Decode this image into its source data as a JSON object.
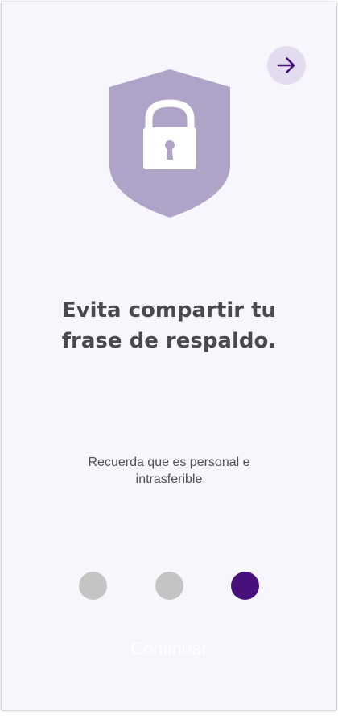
{
  "header": {
    "next_icon": "arrow-right-icon",
    "accent_color": "#48107a"
  },
  "hero": {
    "icon": "shield-lock-icon",
    "shield_color": "#afa3c8"
  },
  "content": {
    "title_line1": "Evita compartir tu",
    "title_line2": "frase de respaldo.",
    "subtitle_line1": "Recuerda que es personal e",
    "subtitle_line2": "intrasferible"
  },
  "pagination": {
    "total": 3,
    "active_index": 2,
    "active_color": "#48107a",
    "inactive_color": "#c4c4c4"
  },
  "footer": {
    "continue_label": "Continuar"
  }
}
